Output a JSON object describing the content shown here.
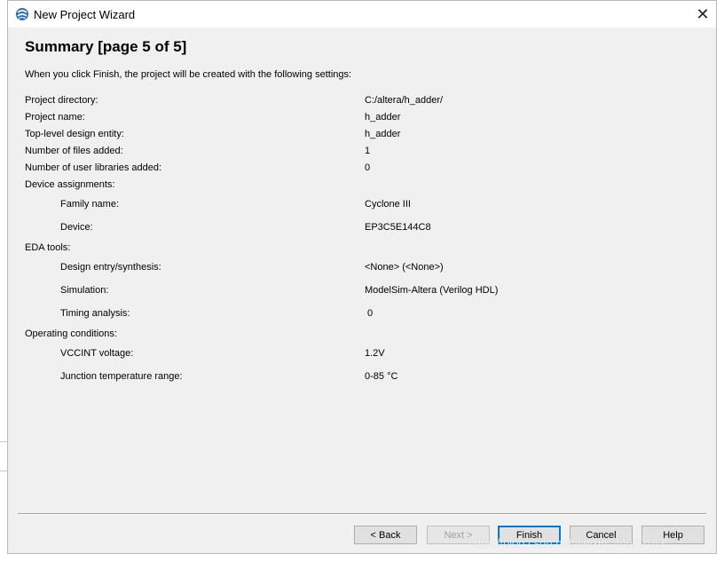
{
  "window": {
    "title": "New Project Wizard",
    "close_glyph": "✕"
  },
  "page": {
    "heading": "Summary [page 5 of 5]",
    "intro": "When you click Finish, the project will be created with the following settings:"
  },
  "settings": [
    {
      "label": "Project directory:",
      "value": "C:/altera/h_adder/"
    },
    {
      "label": "Project name:",
      "value": "h_adder"
    },
    {
      "label": "Top-level design entity:",
      "value": "h_adder"
    },
    {
      "label": "Number of files added:",
      "value": "1"
    },
    {
      "label": "Number of user libraries added:",
      "value": "0"
    },
    {
      "label": "Device assignments:",
      "value": ""
    },
    {
      "label": "Family name:",
      "value": "Cyclone III"
    },
    {
      "label": "Device:",
      "value": "EP3C5E144C8"
    },
    {
      "label": "EDA tools:",
      "value": ""
    },
    {
      "label": "Design entry/synthesis:",
      "value": "<None> (<None>)"
    },
    {
      "label": "Simulation:",
      "value": "ModelSim-Altera (Verilog HDL)"
    },
    {
      "label": "Timing analysis:",
      "value": "0"
    },
    {
      "label": "Operating conditions:",
      "value": ""
    },
    {
      "label": "VCCINT voltage:",
      "value": "1.2V"
    },
    {
      "label": "Junction temperature range:",
      "value": "0-85 °C"
    }
  ],
  "buttons": {
    "back": "< Back",
    "next": "Next >",
    "finish": "Finish",
    "cancel": "Cancel",
    "help": "Help"
  },
  "watermark": "https://blog.csdn.net/weixin_44620183"
}
